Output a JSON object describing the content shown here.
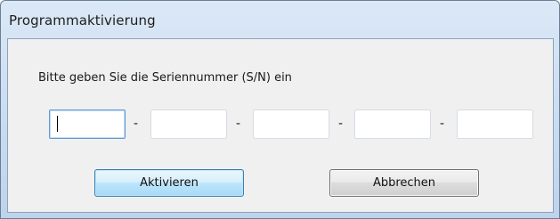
{
  "window": {
    "title": "Programmaktivierung"
  },
  "dialog": {
    "prompt": "Bitte geben Sie die Seriennummer (S/N) ein",
    "serial_fields": [
      {
        "value": "",
        "focused": true
      },
      {
        "value": "",
        "focused": false
      },
      {
        "value": "",
        "focused": false
      },
      {
        "value": "",
        "focused": false
      },
      {
        "value": "",
        "focused": false
      }
    ],
    "separator": "-",
    "activate_label": "Aktivieren",
    "cancel_label": "Abbrechen"
  },
  "colors": {
    "title_bar": "#c9dcf1",
    "client_bg": "#f0f0f0",
    "primary_button_border": "#3c7fb1",
    "focus_border": "#5e9ad6"
  }
}
